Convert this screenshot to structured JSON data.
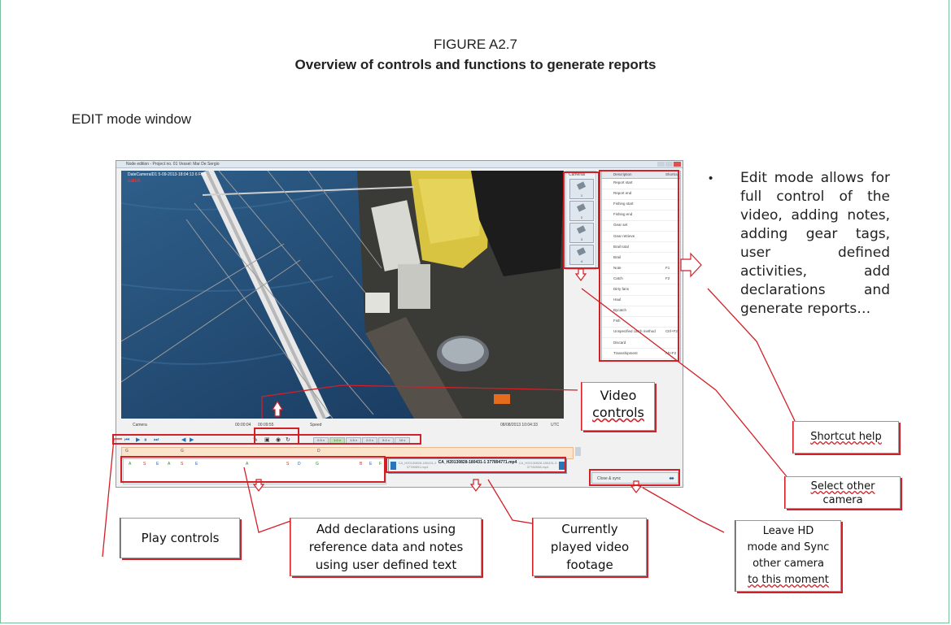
{
  "figure": {
    "label": "FIGURE A2.7",
    "title": "Overview of controls and functions to generate reports"
  },
  "section_title": "EDIT mode window",
  "app": {
    "title_bar": "Node edition - Project no. 01   Vessel: Mar De Sergio",
    "overlay_text": "DateCameraID1 5-09-2013-18:04:13   6 FPS",
    "overlay_logo": "catch",
    "cameras_header": "Cameras",
    "cameras": [
      "1",
      "2",
      "3",
      "4"
    ],
    "desc_header": {
      "description": "Description",
      "shortcut": "Shortcut"
    },
    "descriptions": [
      {
        "name": "Report start",
        "shortcut": ""
      },
      {
        "name": "Report end",
        "shortcut": ""
      },
      {
        "name": "Fishing start",
        "shortcut": ""
      },
      {
        "name": "Fishing end",
        "shortcut": ""
      },
      {
        "name": "Gear set",
        "shortcut": ""
      },
      {
        "name": "Gear retrieve",
        "shortcut": ""
      },
      {
        "name": "Brail total",
        "shortcut": ""
      },
      {
        "name": "Brail",
        "shortcut": ""
      },
      {
        "name": "Note",
        "shortcut": "F1"
      },
      {
        "name": "Catch",
        "shortcut": "F2"
      },
      {
        "name": "Dirty fans",
        "shortcut": ""
      },
      {
        "name": "Haul",
        "shortcut": ""
      },
      {
        "name": "Bycatch",
        "shortcut": ""
      },
      {
        "name": "Fish",
        "shortcut": ""
      },
      {
        "name": "Unspecified catch method",
        "shortcut": "Ctrl+F2"
      },
      {
        "name": "Discard",
        "shortcut": ""
      },
      {
        "name": "Transshipment",
        "shortcut": "Alt+F2"
      }
    ],
    "controls": {
      "camera_label": "Camera",
      "time_elapsed": "00:00:04",
      "time_total": "00:09:55",
      "speed_label": "Speed",
      "datetime": "08/08/2013 10:04:33",
      "timezone": "UTC",
      "speeds": [
        "0.5 x",
        "1.0 x",
        "1.5 x",
        "2.0 x",
        "5.0 x",
        "10 x"
      ]
    },
    "timeline_markers": [
      "G",
      "G",
      "D"
    ],
    "decl_ticks": [
      "A",
      "S",
      "E",
      "A",
      "S",
      "E",
      "A",
      "S",
      "D",
      "G",
      "B",
      "E",
      "F"
    ],
    "video_strip": {
      "prev": "CA_H20130828-180431-2 37789691.mp4",
      "current": "CA_H20130828-180431-1 377894771.mp4",
      "next": "CA_H20130828-180431-3 37784908.mp4"
    },
    "close_sync": "Close & sync"
  },
  "callouts": {
    "video_controls": [
      "Video",
      "controls"
    ],
    "shortcut_help": "Shortcut help",
    "select_other_camera": [
      "Select other",
      "camera"
    ],
    "play_controls": "Play controls",
    "add_declarations": [
      "Add declarations using",
      "reference data and notes",
      "using user defined text"
    ],
    "currently_played": [
      "Currently",
      "played video",
      "footage"
    ],
    "leave_hd": [
      "Leave HD",
      "mode and Sync",
      "other camera",
      "to this moment"
    ]
  },
  "bullet": "Edit mode allows for full control of the video, adding notes, adding gear tags, user defined activities, add declarations and generate reports…",
  "colors": {
    "callout_border": "#d12027",
    "frame": "#7bbf9f",
    "timeline": "#fbe4cc"
  }
}
